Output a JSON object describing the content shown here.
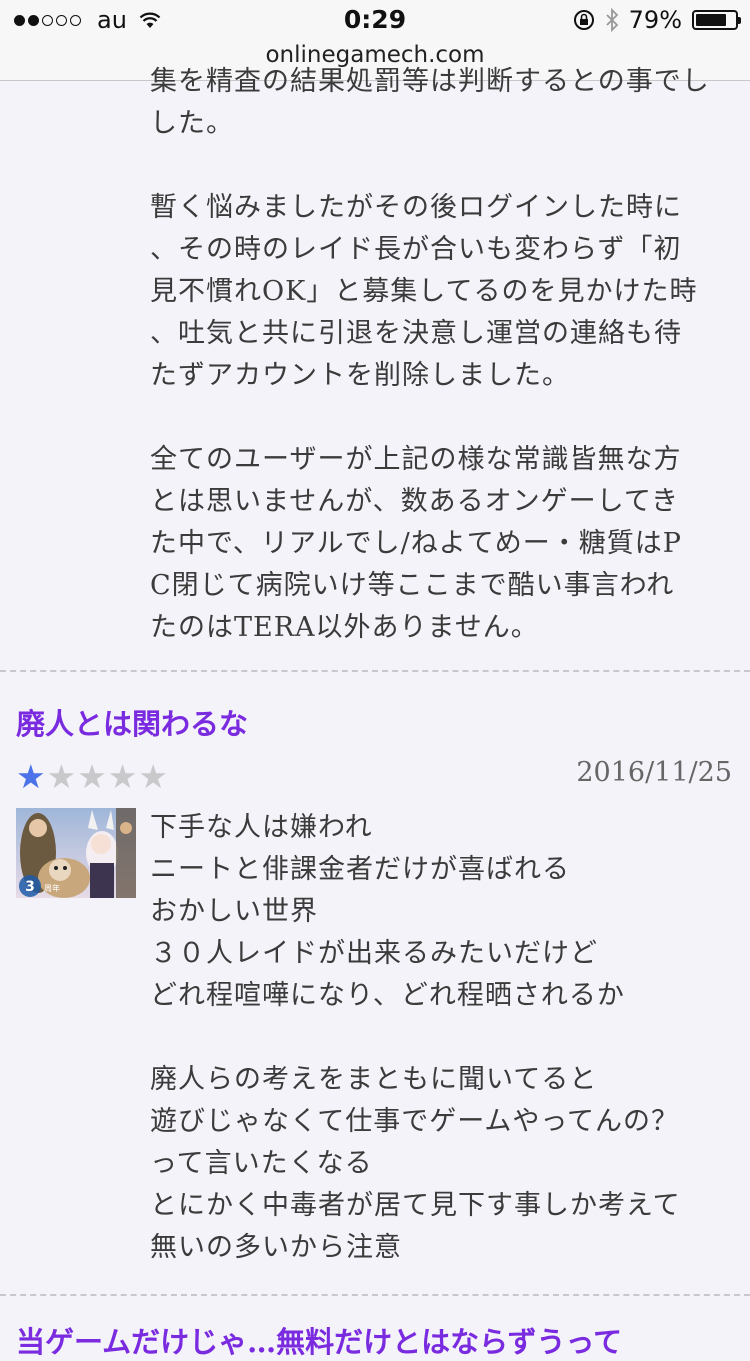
{
  "status_bar": {
    "carrier": "au",
    "time": "0:29",
    "battery_percent": "79%",
    "battery_level": 0.79
  },
  "url": "onlinegamech.com",
  "review_prev": {
    "lines": [
      "集を精査の結果処罰等は判断するとの事でし",
      "した。",
      "",
      "暫く悩みましたがその後ログインした時に",
      "、その時のレイド長が合いも変わらず「初",
      "見不慣れOK」と募集してるのを見かけた時",
      "、吐気と共に引退を決意し運営の連絡も待",
      "たずアカウントを削除しました。",
      "",
      "全てのユーザーが上記の様な常識皆無な方",
      "とは思いませんが、数あるオンゲーしてき",
      "た中で、リアルでし/ねよてめー・糖質はP",
      "C閉じて病院いけ等ここまで酷い事言われ",
      "たのはTERA以外ありません。"
    ]
  },
  "review": {
    "title": "廃人とは関わるな",
    "rating": 1,
    "rating_max": 5,
    "date": "2016/11/25",
    "thumbnail_badge": "3周年",
    "lines": [
      "下手な人は嫌われ",
      "ニートと俳課金者だけが喜ばれる",
      "おかしい世界",
      "３０人レイドが出来るみたいだけど",
      "どれ程喧嘩になり、どれ程晒されるか",
      "",
      "廃人らの考えをまともに聞いてると",
      "遊びじゃなくて仕事でゲームやってんの？",
      "って言いたくなる",
      "とにかく中毒者が居て見下す事しか考えて",
      "無いの多いから注意"
    ]
  },
  "next_review": {
    "title": "当ゲームだけじゃ…無料だけとはならずうって"
  }
}
